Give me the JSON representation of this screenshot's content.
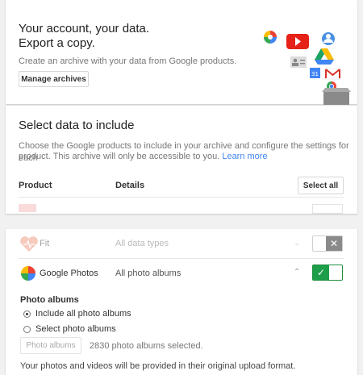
{
  "intro": {
    "title_line1": "Your account, your data.",
    "title_line2": "Export a copy.",
    "subtitle": "Create an archive with your data from Google products.",
    "manage_label": "Manage archives"
  },
  "select": {
    "heading": "Select data to include",
    "desc_line1": "Choose the Google products to include in your archive and configure the settings for each",
    "desc_line2": "product. This archive will only be accessible to you.",
    "learn_more": "Learn more",
    "col_product": "Product",
    "col_details": "Details",
    "select_all_label": "Select all"
  },
  "products": [
    {
      "name": "Fit",
      "details": "All data types",
      "enabled": false,
      "icon": "fit-heart-icon"
    },
    {
      "name": "Google Photos",
      "details": "All photo albums",
      "enabled": true,
      "icon": "photos-pinwheel-icon"
    }
  ],
  "photos": {
    "section_title": "Photo albums",
    "option_all": "Include all photo albums",
    "option_select": "Select photo albums",
    "albums_button": "Photo albums",
    "albums_count": "2830 photo albums selected.",
    "footer": "Your photos and videos will be provided in their original upload format."
  },
  "colors": {
    "accent": "#4285f4",
    "toggle_on": "#1e9e49",
    "toggle_off": "#8a8a8a"
  }
}
